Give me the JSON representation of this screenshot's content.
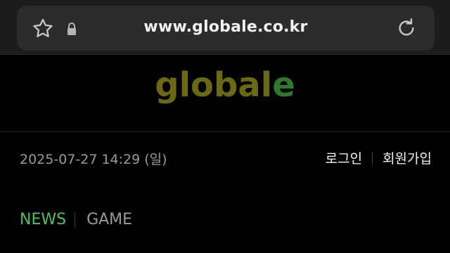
{
  "browser": {
    "url": "www.globale.co.kr",
    "icons": {
      "bookmark": "star-icon",
      "secure": "lock-icon",
      "reload": "reload-icon"
    }
  },
  "site": {
    "logo_main": "global",
    "logo_accent": "e",
    "colors": {
      "logo_main": "#6b6a12",
      "logo_accent": "#2f7a2a",
      "nav_active": "#4fc15a",
      "nav_inactive": "#9a9a9a"
    }
  },
  "header": {
    "datetime": "2025-07-27 14:29 (일)",
    "login_label": "로그인",
    "signup_label": "회원가입"
  },
  "nav": {
    "items": [
      {
        "label": "NEWS",
        "active": true
      },
      {
        "label": "GAME",
        "active": false
      }
    ]
  }
}
